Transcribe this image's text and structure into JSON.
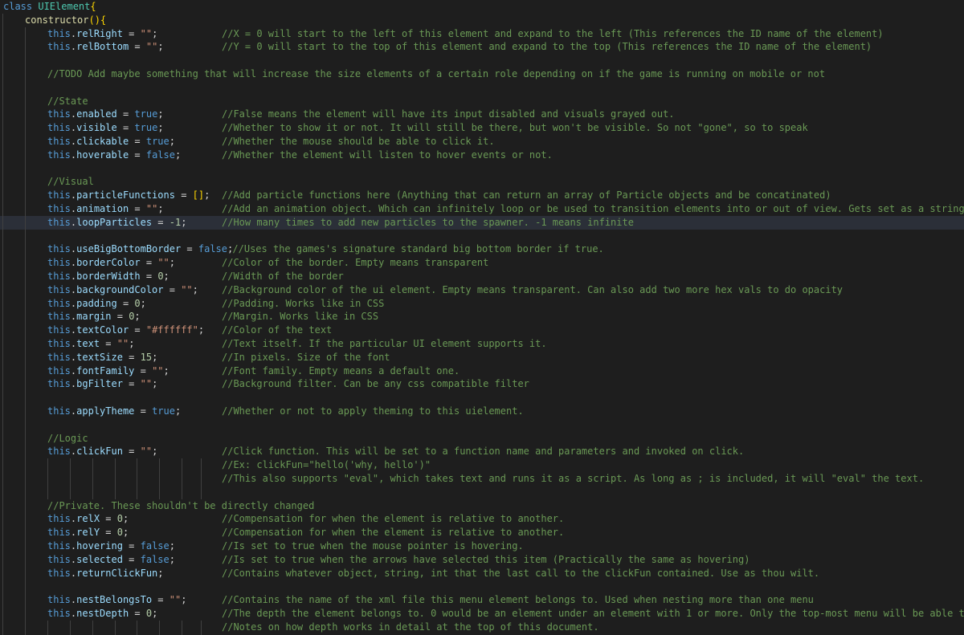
{
  "editor": {
    "lines": [
      {
        "kind": "class",
        "text": "class UIElement{"
      },
      {
        "kind": "ctor",
        "text": "constructor(){"
      },
      {
        "kind": "code",
        "code": "this.relRight = \"\";",
        "comment": "//X = 0 will start to the left of this element and expand to the left (This references the ID name of the element)"
      },
      {
        "kind": "code",
        "code": "this.relBottom = \"\";",
        "comment": "//Y = 0 will start to the top of this element and expand to the top (This references the ID name of the element)"
      },
      {
        "kind": "blank"
      },
      {
        "kind": "comment",
        "comment": "//TODO Add maybe something that will increase the size elements of a certain role depending on if the game is running on mobile or not"
      },
      {
        "kind": "blank"
      },
      {
        "kind": "comment",
        "comment": "//State"
      },
      {
        "kind": "code",
        "code": "this.enabled = true;",
        "comment": "//False means the element will have its input disabled and visuals grayed out."
      },
      {
        "kind": "code",
        "code": "this.visible = true;",
        "comment": "//Whether to show it or not. It will still be there, but won't be visible. So not \"gone\", so to speak"
      },
      {
        "kind": "code",
        "code": "this.clickable = true;",
        "comment": "//Whether the mouse should be able to click it."
      },
      {
        "kind": "code",
        "code": "this.hoverable = false;",
        "comment": "//Whether the element will listen to hover events or not."
      },
      {
        "kind": "blank"
      },
      {
        "kind": "comment",
        "comment": "//Visual"
      },
      {
        "kind": "code",
        "code": "this.particleFunctions = [];",
        "comment": "//Add particle functions here (Anything that can return an array of Particle objects and be concatinated)"
      },
      {
        "kind": "code",
        "code": "this.animation = \"\";",
        "comment": "//Add an animation object. Which can infinitely loop or be used to transition elements into or out of view. Gets set as a string initiall"
      },
      {
        "kind": "code",
        "code": "this.loopParticles = -1;",
        "comment": "//How many times to add new particles to the spawner. -1 means infinite",
        "highlight": true
      },
      {
        "kind": "blank"
      },
      {
        "kind": "code",
        "code": "this.useBigBottomBorder = false;",
        "comment": "//Uses the games's signature standard big bottom border if true.",
        "tight": true
      },
      {
        "kind": "code",
        "code": "this.borderColor = \"\";",
        "comment": "//Color of the border. Empty means transparent"
      },
      {
        "kind": "code",
        "code": "this.borderWidth = 0;",
        "comment": "//Width of the border"
      },
      {
        "kind": "code",
        "code": "this.backgroundColor = \"\";",
        "comment": "//Background color of the ui element. Empty means transparent. Can also add two more hex vals to do opacity"
      },
      {
        "kind": "code",
        "code": "this.padding = 0;",
        "comment": "//Padding. Works like in CSS"
      },
      {
        "kind": "code",
        "code": "this.margin = 0;",
        "comment": "//Margin. Works like in CSS"
      },
      {
        "kind": "code",
        "code": "this.textColor = \"#ffffff\";",
        "comment": "//Color of the text"
      },
      {
        "kind": "code",
        "code": "this.text = \"\";",
        "comment": "//Text itself. If the particular UI element supports it."
      },
      {
        "kind": "code",
        "code": "this.textSize = 15;",
        "comment": "//In pixels. Size of the font"
      },
      {
        "kind": "code",
        "code": "this.fontFamily = \"\";",
        "comment": "//Font family. Empty means a default one."
      },
      {
        "kind": "code",
        "code": "this.bgFilter = \"\";",
        "comment": "//Background filter. Can be any css compatible filter"
      },
      {
        "kind": "blank"
      },
      {
        "kind": "code",
        "code": "this.applyTheme = true;",
        "comment": "//Whether or not to apply theming to this uielement."
      },
      {
        "kind": "blank"
      },
      {
        "kind": "comment",
        "comment": "//Logic"
      },
      {
        "kind": "code",
        "code": "this.clickFun = \"\";",
        "comment": "//Click function. This will be set to a function name and parameters and invoked on click."
      },
      {
        "kind": "cont",
        "comment": "//Ex: clickFun=\"hello('why, hello')\""
      },
      {
        "kind": "cont",
        "comment": "//This also supports \"eval\", which takes text and runs it as a script. As long as ; is included, it will \"eval\" the text."
      },
      {
        "kind": "blank"
      },
      {
        "kind": "comment",
        "comment": "//Private. These shouldn't be directly changed"
      },
      {
        "kind": "code",
        "code": "this.relX = 0;",
        "comment": "//Compensation for when the element is relative to another."
      },
      {
        "kind": "code",
        "code": "this.relY = 0;",
        "comment": "//Compensation for when the element is relative to another."
      },
      {
        "kind": "code",
        "code": "this.hovering = false;",
        "comment": "//Is set to true when the mouse pointer is hovering."
      },
      {
        "kind": "code",
        "code": "this.selected = false;",
        "comment": "//Is set to true when the arrows have selected this item (Practically the same as hovering)"
      },
      {
        "kind": "code",
        "code": "this.returnClickFun;",
        "comment": "//Contains whatever object, string, int that the last call to the clickFun contained. Use as thou wilt."
      },
      {
        "kind": "blank"
      },
      {
        "kind": "code",
        "code": "this.nestBelongsTo = \"\";",
        "comment": "//Contains the name of the xml file this menu element belongs to. Used when nesting more than one menu"
      },
      {
        "kind": "code",
        "code": "this.nestDepth = 0;",
        "comment": "//The depth the element belongs to. 0 would be an element under an element with 1 or more. Only the top-most menu will be able to"
      },
      {
        "kind": "cont",
        "comment": "//Notes on how depth works in detail at the top of this document."
      }
    ]
  },
  "colors": {
    "background": "#1e1e1e",
    "keyword": "#569cd6",
    "className": "#4ec9b0",
    "function": "#dcdcaa",
    "property": "#9cdcfe",
    "string": "#ce9178",
    "number": "#b5cea8",
    "comment": "#6a9955",
    "highlight": "#2b2f38"
  }
}
